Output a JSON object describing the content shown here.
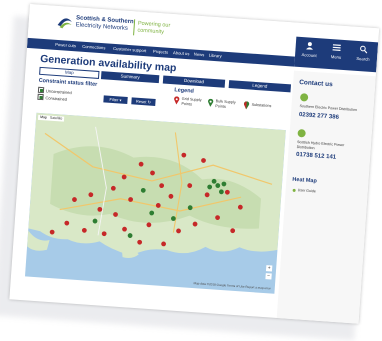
{
  "brand": {
    "name_line1": "Scottish & Southern",
    "name_line2": "Electricity Networks",
    "tagline_line1": "Powering our",
    "tagline_line2": "community",
    "accent": "#7fb342",
    "navy": "#1d3b7a"
  },
  "nav": {
    "items": [
      "Power cuts",
      "Connections",
      "Customer support",
      "Projects",
      "About us",
      "News",
      "Library"
    ]
  },
  "utilities": {
    "account": "Account",
    "menu": "Menu",
    "search": "Search"
  },
  "main": {
    "title": "Generation availability map",
    "tabs": [
      "Map",
      "Summary",
      "Download",
      "Legend"
    ],
    "filter_title": "Constraint status filter",
    "filters": [
      {
        "label": "Unconstrained",
        "checked": true
      },
      {
        "label": "Constrained",
        "checked": true
      }
    ],
    "filter_button": "Filter",
    "reset_button": "Reset",
    "legend_title": "Legend",
    "legend": [
      {
        "line1": "Grid Supply",
        "line2": "Points"
      },
      {
        "line1": "Bulk Supply",
        "line2": "Points"
      },
      {
        "line1": "Substations",
        "line2": ""
      }
    ]
  },
  "map": {
    "map_type": "Map",
    "sat_type": "Satellite",
    "attribution": "Map data ©2018 Google  Terms of Use  Report a map error",
    "zoom_in": "+",
    "zoom_out": "−"
  },
  "sidebar": {
    "contact_title": "Contact us",
    "contacts": [
      {
        "label_line1": "Southern Electric Power Distribution",
        "label_line2": "",
        "number": "02392 277 386"
      },
      {
        "label_line1": "Scottish Hydro Electric Power",
        "label_line2": "Distribution",
        "number": "01738 512 141"
      }
    ],
    "heatmap_title": "Heat Map",
    "heatmap_link": "User Guide"
  }
}
